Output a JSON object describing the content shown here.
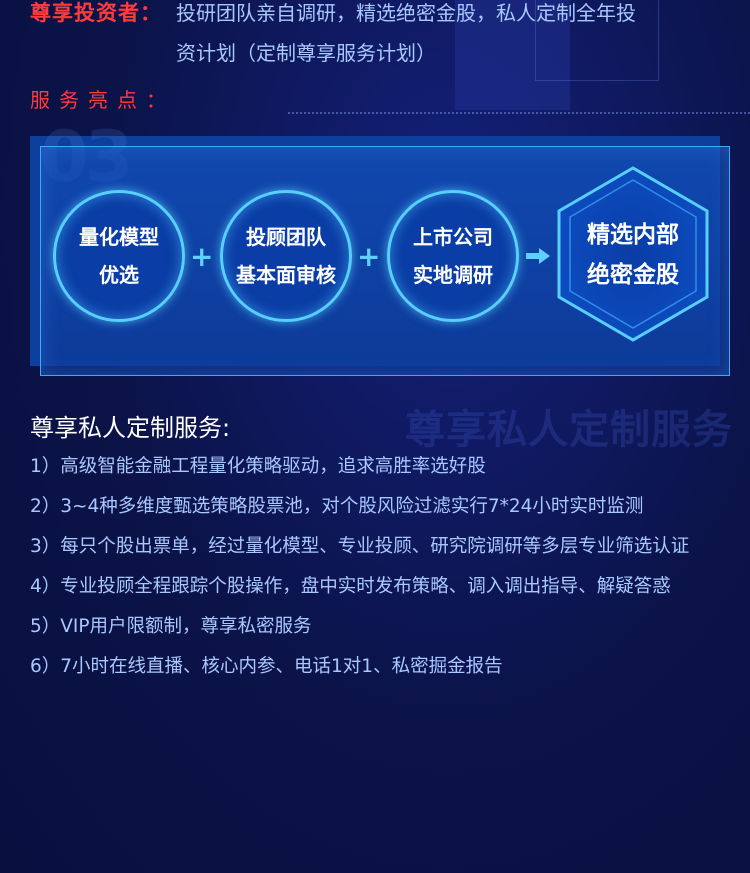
{
  "intro": {
    "label": "尊享投资者：",
    "line1": "投研团队亲自调研，精选绝密金股，私人定制全年投",
    "line2": "资计划（定制尊享服务计划）"
  },
  "highlights": {
    "title": "服务亮点：",
    "watermark": "03",
    "steps": [
      {
        "line1": "量化模型",
        "line2": "优选"
      },
      {
        "line1": "投顾团队",
        "line2": "基本面审核"
      },
      {
        "line1": "上市公司",
        "line2": "实地调研"
      }
    ],
    "plus": "+",
    "result": {
      "line1": "精选内部",
      "line2": "绝密金股"
    }
  },
  "services": {
    "title": "尊享私人定制服务:",
    "watermark": "尊享私人定制服务",
    "items": [
      "1）高级智能金融工程量化策略驱动，追求高胜率选好股",
      "2）3~4种多维度甄选策略股票池，对个股风险过滤实行7*24小时实时监测",
      "3）每只个股出票单，经过量化模型、专业投顾、研究院调研等多层专业筛选认证",
      "4）专业投顾全程跟踪个股操作，盘中实时发布策略、调入调出指导、解疑答惑",
      "5）VIP用户限额制，尊享私密服务",
      "6）7小时在线直播、核心内参、电话1对1、私密掘金报告"
    ]
  },
  "colors": {
    "background": "#0b1348",
    "accent_red": "#ff3b3b",
    "text_blue": "#a9c8ff",
    "glow_cyan": "#58cfff"
  }
}
